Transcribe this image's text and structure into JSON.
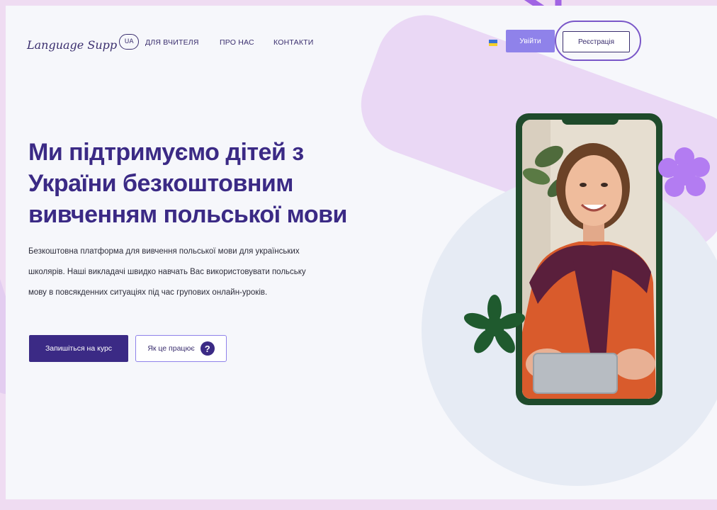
{
  "brand": {
    "name": "Language Supp",
    "badge": "UA"
  },
  "nav": {
    "links": [
      "ДЛЯ ВЧИТЕЛЯ",
      "ПРО НАС",
      "КОНТАКТИ"
    ],
    "login": "Увійти",
    "register": "Реєстрація"
  },
  "hero": {
    "headline": "Ми підтримуємо дітей з України безкоштовним вивченням польської мови",
    "description": "Безкоштовна платформа для вивчення польської мови для українських школярів. Наші викладачі швидко навчать Вас використовувати польську мову в повсякденних ситуаціях під час групових онлайн-уроків.",
    "cta_primary": "Запишіться на курс",
    "cta_secondary": "Як це працює",
    "help_glyph": "?"
  },
  "icons": {
    "flag": "ukraine-flag-icon",
    "help": "question-circle-icon",
    "annotation_arrow": "arrow-icon",
    "decor_flower_purple": "flower-icon",
    "decor_flower_green": "flower-icon"
  },
  "colors": {
    "primary": "#3b2a85",
    "accent": "#8f82ea",
    "highlight_ring": "#7a57c8",
    "phone_frame": "#1f4a2b",
    "flower_purple": "#b37cf2",
    "flower_green": "#1f5a2e"
  }
}
